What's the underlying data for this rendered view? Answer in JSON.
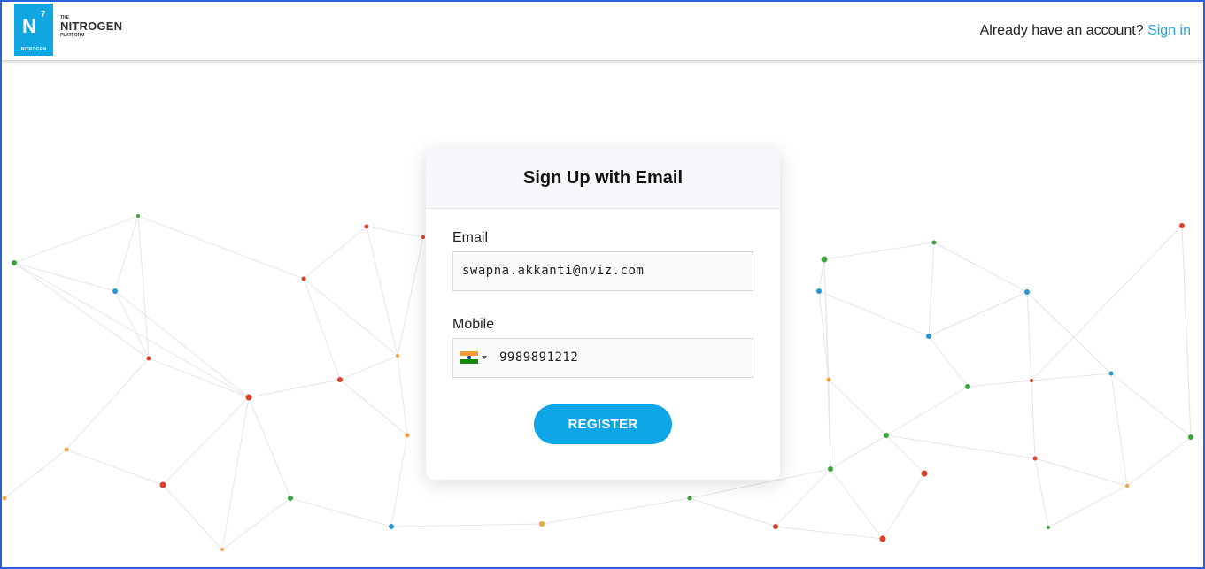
{
  "logo": {
    "symbol": "N",
    "superscript": "7",
    "caption": "NITROGEN",
    "wordmark_the": "THE",
    "wordmark_main": "NITROGEN",
    "wordmark_platform": "PLATFORM",
    "color": "#0fa6e2"
  },
  "header": {
    "prompt": "Already have an account?",
    "signin_link": "Sign in",
    "link_color": "#2a9fd8"
  },
  "form": {
    "title": "Sign Up with Email",
    "email_label": "Email",
    "email_value": "swapna.akkanti@nviz.com",
    "mobile_label": "Mobile",
    "country_flag": "india-flag-icon",
    "mobile_value": "9989891212",
    "register_label": "REGISTER",
    "accent": "#0ea5e6"
  }
}
